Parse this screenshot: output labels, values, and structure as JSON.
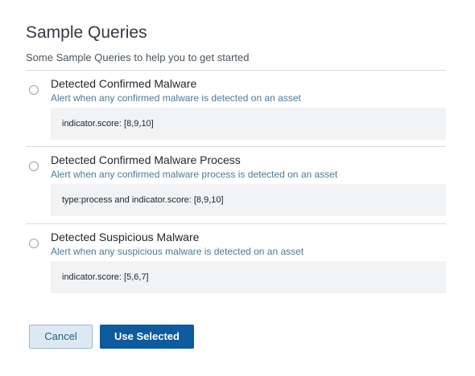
{
  "header": {
    "title": "Sample Queries",
    "subtitle": "Some Sample Queries to help you to get started"
  },
  "queries": [
    {
      "title": "Detected Confirmed Malware",
      "description": "Alert when any confirmed malware is detected on an asset",
      "query": "indicator.score: [8,9,10]",
      "selected": false
    },
    {
      "title": "Detected Confirmed Malware Process",
      "description": "Alert when any confirmed malware process is detected on an asset",
      "query": "type:process and indicator.score: [8,9,10]",
      "selected": false
    },
    {
      "title": "Detected Suspicious Malware",
      "description": "Alert when any suspicious malware is detected on an asset",
      "query": "indicator.score: [5,6,7]",
      "selected": false
    }
  ],
  "actions": {
    "cancel_label": "Cancel",
    "use_selected_label": "Use Selected"
  },
  "colors": {
    "primary_button": "#0d5b9f",
    "secondary_button": "#dde9f2",
    "description_text": "#4e7a93"
  }
}
